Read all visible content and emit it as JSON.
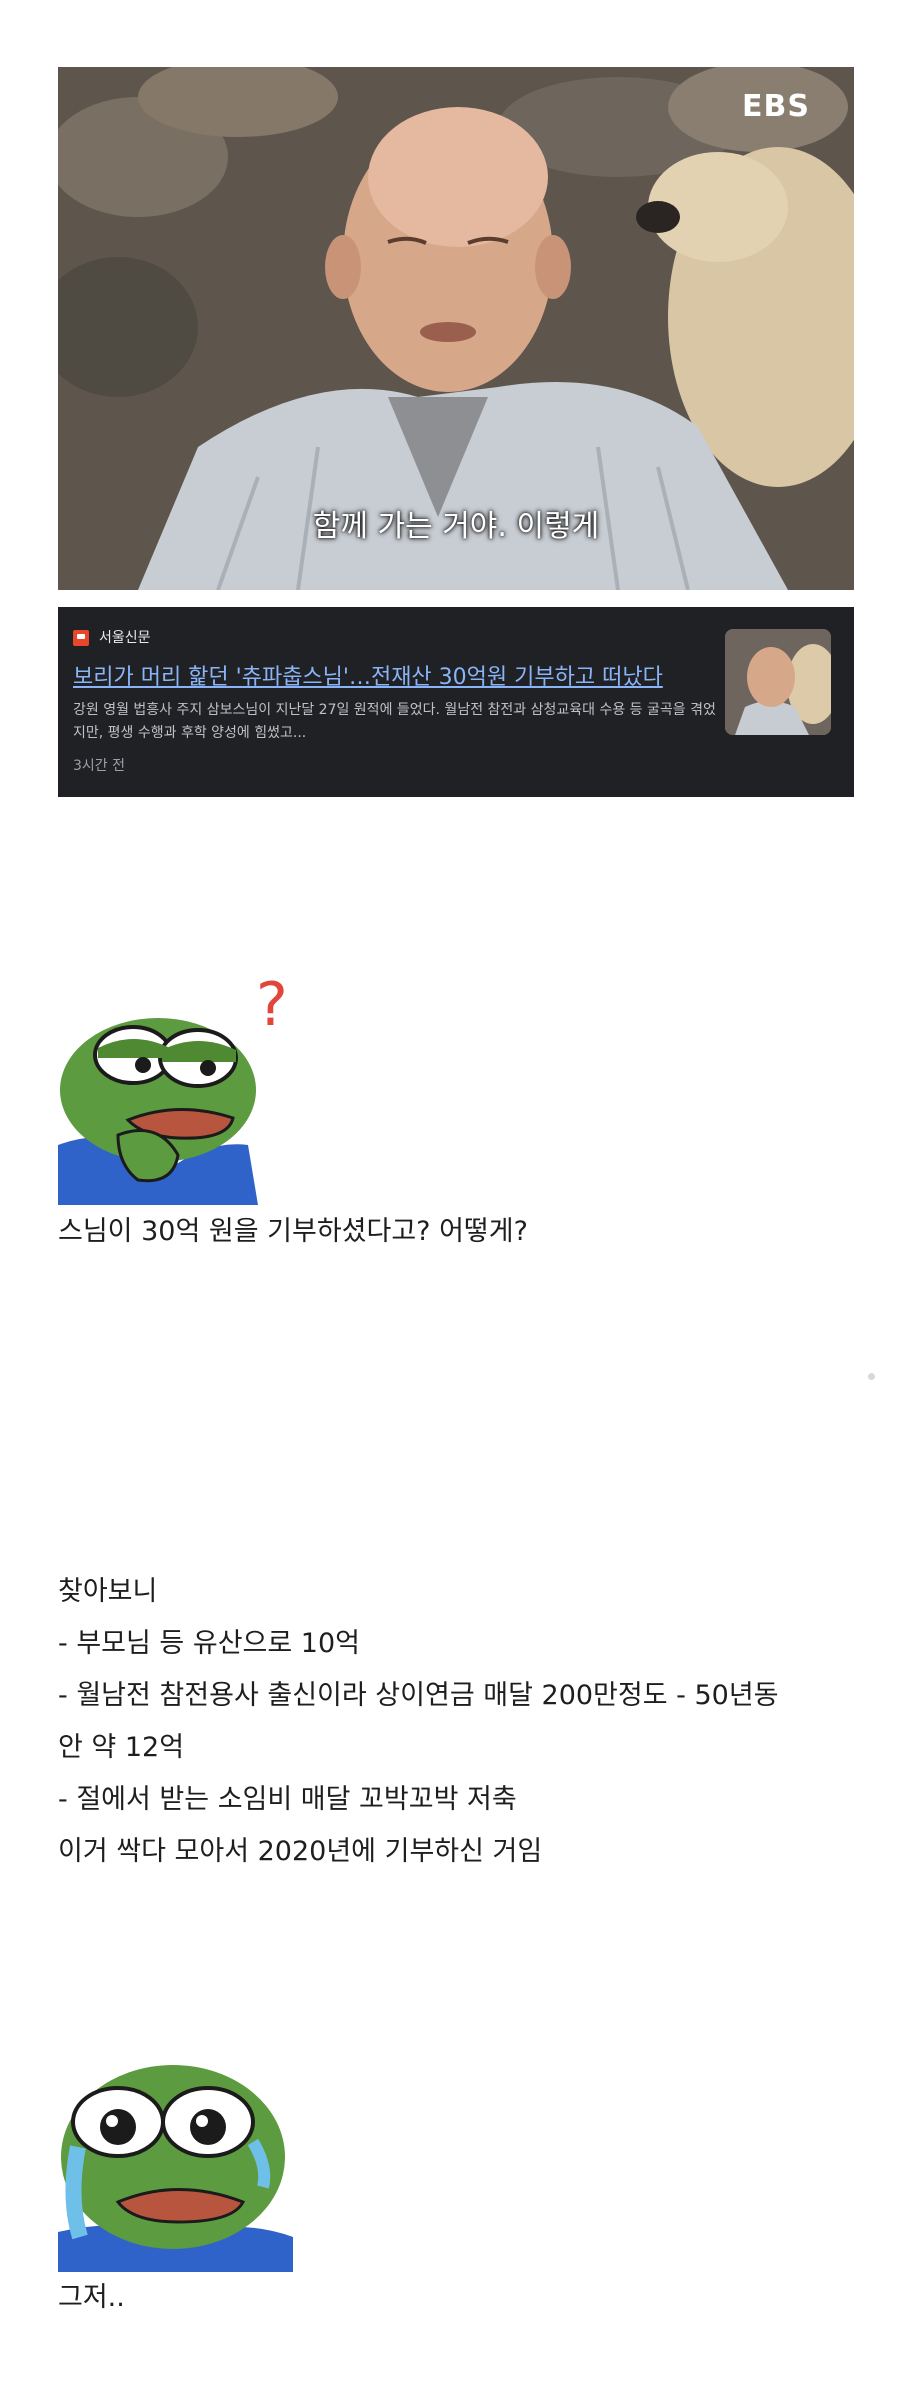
{
  "video": {
    "channel_logo": "EBS",
    "subtitle": "함께 가는 거야. 이렇게"
  },
  "news": {
    "source": "서울신문",
    "title": "보리가 머리 핥던 '츄파춥스님'…전재산 30억원 기부하고 떠났다",
    "snippet": "강원 영월 법흥사 주지 삼보스님이 지난달 27일 원적에 들었다. 월남전 참전과 삼청교육대 수용 등 굴곡을 겪었지만, 평생 수행과 후학 양성에 힘썼고...",
    "time": "3시간 전",
    "thumbnail_icon": "monk-with-dog-thumbnail"
  },
  "post": {
    "sticker1": "pepe-thinking-icon",
    "line_question": "스님이 30억 원을 기부하셨다고? 어떻게?",
    "lines": [
      "찾아보니",
      "- 부모님 등 유산으로 10억",
      "- 월남전 참전용사 출신이라 상이연금 매달 200만정도 - 50년동",
      "안 약 12억",
      "- 절에서 받는 소임비 매달 꼬박꼬박 저축",
      "이거 싹다 모아서 2020년에 기부하신 거임"
    ],
    "sticker2": "pepe-crying-icon",
    "line_end": "그저.."
  }
}
